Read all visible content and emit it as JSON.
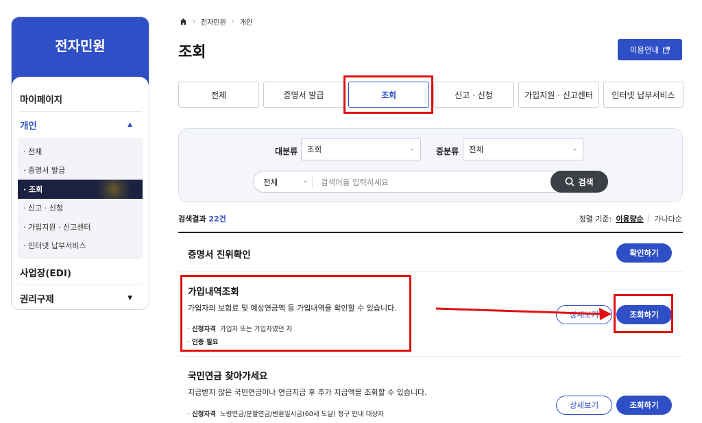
{
  "sidebar": {
    "title": "전자민원",
    "items": [
      {
        "label": "마이페이지"
      },
      {
        "label": "개인"
      },
      {
        "label": "사업장(EDI)"
      },
      {
        "label": "권리구제"
      }
    ],
    "sub_items": [
      {
        "label": "· 전체"
      },
      {
        "label": "· 증명서 발급"
      },
      {
        "label": "· 조회"
      },
      {
        "label": "· 신고 · 신청"
      },
      {
        "label": "· 가입지원 · 신고센터"
      },
      {
        "label": "· 인터넷 납부서비스"
      }
    ]
  },
  "breadcrumb": {
    "level1": "전자민원",
    "level2": "개인"
  },
  "page_title": "조회",
  "guide_button": "이용안내",
  "tabs": [
    {
      "label": "전체"
    },
    {
      "label": "증명서 발급"
    },
    {
      "label": "조회"
    },
    {
      "label": "신고 · 신청"
    },
    {
      "label": "가입지원 · 신고센터"
    },
    {
      "label": "인터넷 납부서비스"
    }
  ],
  "filters": {
    "major_label": "대분류",
    "major_value": "조회",
    "minor_label": "중분류",
    "minor_value": "전체",
    "scope_value": "전체",
    "search_placeholder": "검색어를 입력하세요",
    "search_button": "검색"
  },
  "results": {
    "count_prefix": "검색결과",
    "count": "22건",
    "sort_label": "정렬 기준:",
    "sort_current": "이용량순",
    "sort_other": "가나다순"
  },
  "rows": [
    {
      "title": "증명서 진위확인",
      "button": "확인하기"
    },
    {
      "title": "가입내역조회",
      "desc": "가입자의 보험료 및 예상연금액 등 가입내역을 확인할 수 있습니다.",
      "meta1_label": "신청자격",
      "meta1_value": "가입자 또는 가입자였던 자",
      "meta2_label": "인증 필요",
      "detail_button": "상세보기",
      "button": "조회하기"
    },
    {
      "title": "국민연금 찾아가세요",
      "desc": "지급받지 않은 국민연금이나 연금지급 후 추가 지급액을 조회할 수 있습니다.",
      "meta1_label": "신청자격",
      "meta1_value": "노령연금/분할연금/반환일시금(60세 도달) 청구 안내 대상자",
      "detail_button": "상세보기",
      "button": "조회하기"
    }
  ],
  "colors": {
    "accent": "#2f4fc6",
    "highlight": "#e01010",
    "dark": "#3c3f46"
  }
}
